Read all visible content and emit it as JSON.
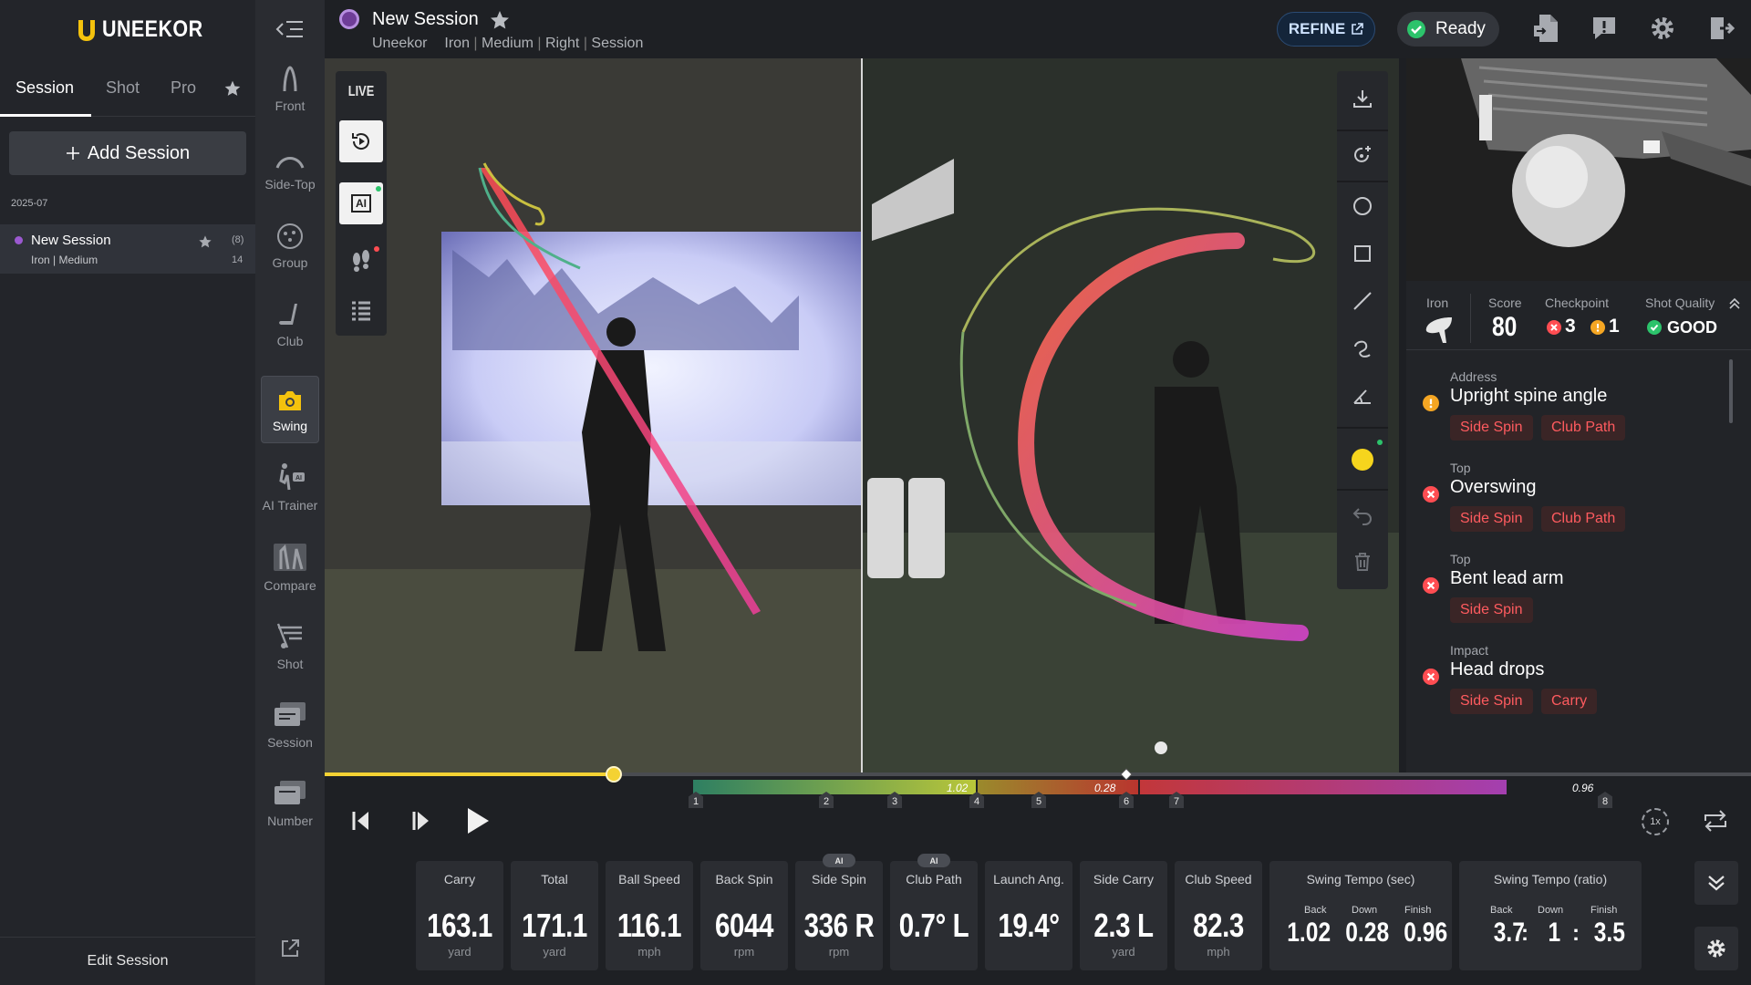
{
  "app": {
    "brand": "UNEEKOR"
  },
  "sidebar": {
    "tabs": [
      {
        "label": "Session"
      },
      {
        "label": "Shot"
      },
      {
        "label": "Pro"
      }
    ],
    "add_session_label": "Add Session",
    "date_group": "2025-07",
    "session": {
      "title": "New Session",
      "details": "Iron | Medium",
      "count": "(8)",
      "number": "14"
    },
    "edit_session_label": "Edit Session"
  },
  "rail": [
    {
      "label": "Front",
      "icon": "front-view-icon"
    },
    {
      "label": "Side-Top",
      "icon": "side-top-view-icon"
    },
    {
      "label": "Group",
      "icon": "group-icon"
    },
    {
      "label": "Club",
      "icon": "club-icon"
    },
    {
      "label": "Swing",
      "icon": "swing-camera-icon"
    },
    {
      "label": "AI Trainer",
      "icon": "ai-trainer-icon"
    },
    {
      "label": "Compare",
      "icon": "compare-icon"
    },
    {
      "label": "Shot",
      "icon": "shot-icon"
    },
    {
      "label": "Session",
      "icon": "session-icon"
    },
    {
      "label": "Number",
      "icon": "number-icon"
    }
  ],
  "header": {
    "title": "New Session",
    "subtitle_parts": [
      "Uneekor",
      "Iron",
      "Medium",
      "Right",
      "Session"
    ],
    "refine_label": "REFINE",
    "status_label": "Ready"
  },
  "video": {
    "live_label": "LIVE",
    "ai_label": "AI"
  },
  "analysis": {
    "club_type": "Iron",
    "score_label": "Score",
    "score": "80",
    "checkpoint_label": "Checkpoint",
    "checkpoint_errors": "3",
    "checkpoint_warnings": "1",
    "quality_label": "Shot Quality",
    "quality": "GOOD",
    "feedback": [
      {
        "phase": "Address",
        "title": "Upright spine angle",
        "severity": "warning",
        "tags": [
          "Side Spin",
          "Club Path"
        ]
      },
      {
        "phase": "Top",
        "title": "Overswing",
        "severity": "error",
        "tags": [
          "Side Spin",
          "Club Path"
        ]
      },
      {
        "phase": "Top",
        "title": "Bent lead arm",
        "severity": "error",
        "tags": [
          "Side Spin"
        ]
      },
      {
        "phase": "Impact",
        "title": "Head drops",
        "severity": "error",
        "tags": [
          "Side Spin",
          "Carry"
        ]
      }
    ]
  },
  "timeline": {
    "progress_fraction": 0.165,
    "checkpoints": [
      "1",
      "2",
      "3",
      "4",
      "5",
      "6",
      "7",
      "8"
    ],
    "tempo_labels": [
      "1.02",
      "0.28",
      "0.96"
    ],
    "speed_label": "1x"
  },
  "metrics": [
    {
      "label": "Carry",
      "value": "163.1",
      "unit": "yard",
      "ai": false
    },
    {
      "label": "Total",
      "value": "171.1",
      "unit": "yard",
      "ai": false
    },
    {
      "label": "Ball Speed",
      "value": "116.1",
      "unit": "mph",
      "ai": false
    },
    {
      "label": "Back Spin",
      "value": "6044",
      "unit": "rpm",
      "ai": false
    },
    {
      "label": "Side Spin",
      "value": "336 R",
      "unit": "rpm",
      "ai": true
    },
    {
      "label": "Club Path",
      "value": "0.7° L",
      "unit": "",
      "ai": true
    },
    {
      "label": "Launch Ang.",
      "value": "19.4°",
      "unit": "",
      "ai": false
    },
    {
      "label": "Side Carry",
      "value": "2.3 L",
      "unit": "yard",
      "ai": false
    },
    {
      "label": "Club Speed",
      "value": "82.3",
      "unit": "mph",
      "ai": false
    }
  ],
  "ai_badge_label": "AI",
  "tempo_sec": {
    "label": "Swing Tempo (sec)",
    "sub": [
      "Back",
      "Down",
      "Finish"
    ],
    "values": [
      "1.02",
      "0.28",
      "0.96"
    ]
  },
  "tempo_ratio": {
    "label": "Swing Tempo (ratio)",
    "sub": [
      "Back",
      "Down",
      "Finish"
    ],
    "values": [
      "3.7",
      "1",
      "3.5"
    ],
    "sep": ":"
  }
}
